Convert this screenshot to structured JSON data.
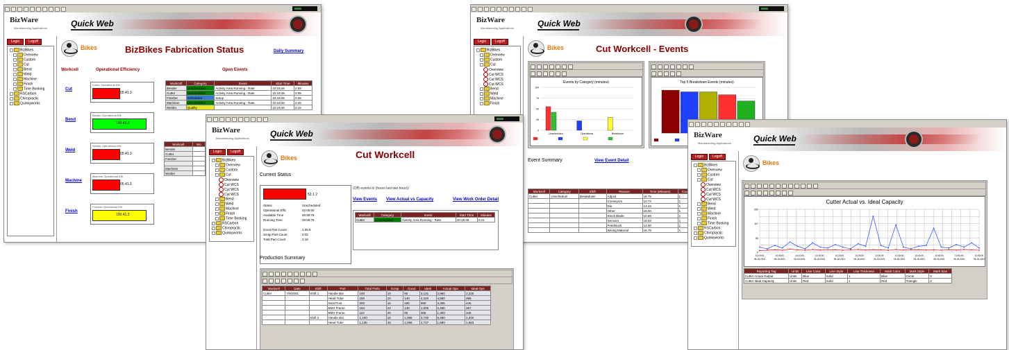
{
  "brand": {
    "logo": "BizWare",
    "logo_sub": "Manufacturing Applications",
    "product": "Quick Web",
    "bikes_label": "Bikes"
  },
  "sidebar_buttons": [
    "Login",
    "Logoff"
  ],
  "win1": {
    "title": "BizBikes Fabrication Status",
    "link": "Daily Summary",
    "col_workcell": "Workcell",
    "col_efficiency": "Operational Efficiency",
    "col_events": "Open Events",
    "workcells": [
      {
        "name": "Cut",
        "caption": "Cutter Operational Effi",
        "pct": "05.41.3",
        "color": "#ff0000",
        "level": 0.45
      },
      {
        "name": "Bend",
        "caption": "Bender Operational Effi",
        "pct": "100.43.3",
        "color": "#00ff00",
        "level": 0.9
      },
      {
        "name": "Weld",
        "caption": "Welder Operational Effi",
        "pct": "05.41.3",
        "color": "#ff0000",
        "level": 0.45
      },
      {
        "name": "Machine",
        "caption": "Machine Operational Effi",
        "pct": "05.41.3",
        "color": "#ff0000",
        "level": 0.45
      },
      {
        "name": "Finish",
        "caption": "Finisher Operational Effi",
        "pct": "100.41.3",
        "color": "#ffff00",
        "level": 0.9
      }
    ],
    "events_headers": [
      "Workcell",
      "Category",
      "Event",
      "Start Time",
      "Minutes"
    ],
    "events_rows": [
      [
        "Bender",
        "Unscheduled",
        "Activity Area Running - Rate",
        "10:19:46",
        "2:59"
      ],
      [
        "Cutter",
        "Unscheduled",
        "Activity Area Running - Rate",
        "10:19:46",
        "3:08"
      ],
      [
        "Finisher",
        "Scheduled",
        "Setup",
        "10:19:46",
        "3:28"
      ],
      [
        "Machiner",
        "Unscheduled",
        "Activity Area Running - Rate",
        "10:19:46",
        "3:45"
      ],
      [
        "Welder",
        "Quality",
        "",
        "10:19:46",
        "2:15"
      ]
    ],
    "lower_headers": [
      "Workcell",
      "Wo"
    ],
    "lower_rows": [
      "Bender",
      "Cutter",
      "Finisher",
      "",
      "Machiner",
      "Welder"
    ]
  },
  "win2": {
    "title": "Cut Workcell",
    "current_status": "Current Status",
    "gauge_pct": "52.1 2",
    "open_note": "(Off) events in (hours last two hours)",
    "links": [
      "View Events",
      "View Actual vs Capacity",
      "View Work Order Detail"
    ],
    "status_lines": [
      "Status",
      "Operational Effic",
      "Available Time",
      "Running Time",
      "",
      "Good Part Count",
      "Scrap Part Count",
      "Total Part Count"
    ],
    "status_values": [
      "Unscheduled",
      "02:00:00",
      "00:58:78",
      "00:58:78",
      "",
      "2.05:6",
      "0:02",
      "2:18"
    ],
    "event_headers": [
      "Workcell",
      "Category",
      "Event",
      "Start Time",
      "Minutes"
    ],
    "event_row": [
      "Cutter",
      "Unscheduled",
      "Activity Area Running - Rate",
      "10:19:46",
      "3:11"
    ],
    "production_summary": "Production Summary",
    "prod_headers": [
      "Workcell",
      "Date",
      "Shift",
      "Part",
      "Total Parts",
      "Scrap",
      "Good",
      "Ideal",
      "Actual Ops",
      "Ideal Ops"
    ],
    "prod_rows": [
      [
        "Cutter",
        "7/9/2001",
        "Shift 1",
        "Handle Bar",
        "100",
        "10",
        "90",
        "3,131",
        "2,960",
        "2,225"
      ],
      [
        "",
        "",
        "",
        "Head Tube",
        "150",
        "10",
        "140",
        "4,240",
        "4,850",
        "386"
      ],
      [
        "",
        "",
        "",
        "Seat Post",
        "200",
        "15",
        "185",
        "550",
        "3,305",
        "445"
      ],
      [
        "",
        "",
        "",
        "BMX Frame",
        "164",
        "24",
        "140",
        "1,005",
        "2,450",
        "367"
      ],
      [
        "",
        "",
        "",
        "BMX Frame",
        "110",
        "20",
        "90",
        "365",
        "1,300",
        "345"
      ],
      [
        "",
        "",
        "Shift 2",
        "Handle Bar",
        "1,100",
        "15",
        "1,085",
        "3,730",
        "5,480",
        "2,340"
      ],
      [
        "",
        "",
        "",
        "Head Tube",
        "1,136",
        "40",
        "1,096",
        "2,737",
        "1,680",
        "1,663"
      ]
    ]
  },
  "win3": {
    "title": "Cut Workcell - Events",
    "chart1_title": "Events by Category (minutes)",
    "chart2_title": "Top 5 Breakdown Events (minutes)",
    "event_summary": "Event Summary",
    "view_detail": "View Event Detail",
    "summary_headers": [
      "Workcell",
      "Category",
      "Shift",
      "Reason",
      "Time (Minutes)",
      "Count"
    ],
    "summary_first": [
      "Cutter",
      "Unschedule",
      "Breakdown"
    ],
    "reasons": [
      [
        "Adjust",
        "16.75"
      ],
      [
        "Conveyors",
        "10.73"
      ],
      [
        "Die",
        "13.43"
      ],
      [
        "Other",
        "18.00"
      ],
      [
        "Stock Blade",
        "10.66"
      ],
      [
        "Sensors",
        "18.03"
      ],
      [
        "Feedstock",
        "14.00"
      ],
      [
        "Wrong Material",
        "18.75"
      ]
    ],
    "chart_data": [
      {
        "type": "bar",
        "title": "Events by Category (minutes)",
        "categories": [
          "Unscheduled",
          "Operational",
          "Breakdown"
        ],
        "series": [
          {
            "color": "#ff3030",
            "values": [
              55,
              0,
              0
            ]
          },
          {
            "color": "#2040ff",
            "values": [
              0,
              22,
              0
            ]
          },
          {
            "color": "#ffff30",
            "values": [
              0,
              0,
              30
            ]
          },
          {
            "color": "#30c030",
            "values": [
              42,
              0,
              0
            ]
          }
        ],
        "ylim": [
          0,
          100
        ]
      },
      {
        "type": "bar",
        "title": "Top 5 Breakdown Events (minutes)",
        "values": [
          18.75,
          18.03,
          18.0,
          16.75,
          14.0
        ],
        "colors": [
          "#8b0000",
          "#2040ff",
          "#b0b000",
          "#ff3030",
          "#20b020"
        ],
        "ylim": [
          0,
          20
        ]
      }
    ]
  },
  "win4": {
    "chart_title": "Cutter Actual vs. Ideal Capacity",
    "legend_headers": [
      "Reporting Tag",
      "Units",
      "Line Color",
      "Line Style",
      "Line Thickness",
      "Mark Color",
      "Mark Style",
      "Mark Size"
    ],
    "legend_rows": [
      [
        "Cutter Actual Output",
        "Units",
        "Blue",
        "Solid",
        "1",
        "Blue",
        "Circle",
        "3"
      ],
      [
        "Cutter Ideal Capacity",
        "Units",
        "Red",
        "Solid",
        "1",
        "Red",
        "Triangle",
        "3"
      ]
    ],
    "chart_data": {
      "type": "line",
      "title": "Cutter Actual vs. Ideal Capacity",
      "x": [
        "10:00:00 06-18-2001",
        "10:05:00 06-18-2001",
        "10:10:00 06-18-2001",
        "10:15:00 06-18-2001",
        "10:20:00 06-18-2001",
        "10:25:00 06-18-2001",
        "10:30:00 06-18-2001",
        "10:35:00 06-18-2001",
        "10:40:00 06-18-2001",
        "10:45:00 06-18-2001",
        "10:50:00 06-18-2001",
        "10:55:00 06-18-2001"
      ],
      "ylim": [
        0,
        250
      ],
      "series": [
        {
          "name": "Cutter Actual Output",
          "color": "#3a5cff",
          "values": [
            30,
            20,
            40,
            25,
            60,
            35,
            20,
            55,
            30,
            25,
            45,
            30,
            20,
            50,
            35,
            210,
            40,
            25,
            160,
            30,
            20,
            35,
            40,
            140,
            30,
            25,
            45,
            30,
            55,
            25
          ]
        },
        {
          "name": "Cutter Ideal Capacity",
          "color": "#e02020",
          "values": [
            10,
            12,
            15,
            12,
            18,
            14,
            12,
            16,
            13,
            14,
            15,
            12,
            14,
            16,
            13,
            15,
            14,
            12,
            16,
            13,
            14,
            15,
            13,
            14,
            12,
            15,
            13,
            16,
            14,
            12
          ]
        }
      ]
    }
  }
}
